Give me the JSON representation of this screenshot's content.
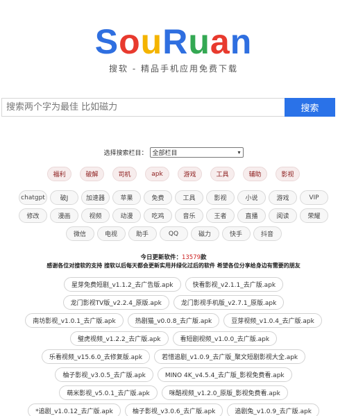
{
  "logo": {
    "letters": [
      {
        "char": "S",
        "color": "#2f6fe0"
      },
      {
        "char": "o",
        "color": "#e83a2e"
      },
      {
        "char": "u",
        "color": "#f4b400"
      },
      {
        "char": "R",
        "color": "#2f6fe0"
      },
      {
        "char": "u",
        "color": "#34a853"
      },
      {
        "char": "a",
        "color": "#e83a2e"
      },
      {
        "char": "n",
        "color": "#2f6fe0"
      }
    ]
  },
  "subtitle": "搜软 - 精品手机应用免费下载",
  "search": {
    "placeholder": "搜索两个字为最佳 比如磁力",
    "button_label": "搜索"
  },
  "column": {
    "label": "选择搜索栏目：",
    "selected": "全部栏目"
  },
  "hot_tags": [
    "福利",
    "破解",
    "司机",
    "apk",
    "游戏",
    "工具",
    "辅助",
    "影视"
  ],
  "tags_row1": [
    "chatgpt",
    "破J",
    "加速器",
    "苹果",
    "免费",
    "工具",
    "影视",
    "小说",
    "游戏",
    "VIP"
  ],
  "tags_row2": [
    "修改",
    "漫画",
    "视频",
    "动漫",
    "吃鸡",
    "音乐",
    "王者",
    "直播",
    "阅读",
    "荣耀"
  ],
  "tags_row3": [
    "微信",
    "电视",
    "助手",
    "QQ",
    "磁力",
    "快手",
    "抖音"
  ],
  "update": {
    "prefix": "今日更新软件：",
    "count": "13579",
    "suffix": "款"
  },
  "thanks": "感谢各位对搜软的支持 搜软以后每天都会更新实用并绿化过后的软件 希望各位分享给身边有需要的朋友",
  "files": [
    [
      "星芽免费短剧_v1.1.2_去广告版.apk",
      "快看影视_v2.1.1_去广版.apk"
    ],
    [
      "龙门影视TV版_v2.2.4_原版.apk",
      "龙门影视手机版_v2.7.1_原版.apk"
    ],
    [
      "南坊影视_v1.0.1_去广版.apk",
      "热剧猫_v0.0.8_去广版.apk",
      "豆芽视频_v1.0.4_去广版.apk"
    ],
    [
      "璧虎视频_v1.2.2_去广版.apk",
      "看短剧视频_v1.0.0_去广版.apk"
    ],
    [
      "乐看视频_v15.6.0_去修复版.apk",
      "若惜追剧_v1.0.9_去广版_聚文短剧影视大全.apk"
    ],
    [
      "柚子影视_v3.0.5_去广版.apk",
      "MINO 4K_v4.5.4_去广版_影视免费看.apk"
    ],
    [
      "萌米影视_v5.0.1_去广版.apk",
      "咪酷视频_v1.2.0_原版_影视免费看.apk"
    ],
    [
      "*追剧_v1.0.12_去广版.apk",
      "柚子影视_v3.0.6_去广版.apk",
      "追剧兔_v1.0.9_去广版.apk"
    ]
  ]
}
